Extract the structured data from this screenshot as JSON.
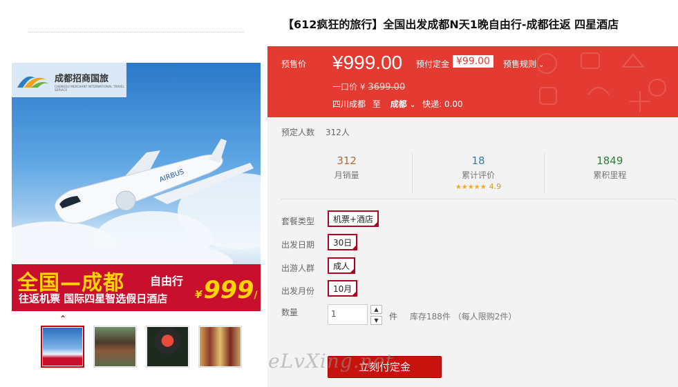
{
  "gallery": {
    "hero": {
      "logo_text": "成都招商国旅",
      "logo_sub": "CHENGDU MERCHANT INTERNATIONAL TRAVEL SERVICE",
      "banner_main": "全国—成都",
      "banner_free": "自由行",
      "banner_sub": "往返机票 国际四星智选假日酒店",
      "banner_price": "999",
      "banner_yen": "¥",
      "banner_per": "/人"
    },
    "thumbnails": [
      "thumb-plane",
      "thumb-temple",
      "thumb-opera",
      "thumb-puppets"
    ],
    "active_thumb": 0
  },
  "product": {
    "title": "【612疯狂的旅行】全国出发成都N天1晚自由行-成都往返 四星酒店",
    "presale_label": "预售价",
    "price": "¥999.00",
    "deposit_label": "预付定金",
    "deposit_value": "¥99.00",
    "rules_label": "预售规则",
    "one_price_label": "一口价 ¥",
    "one_price_value": "3699.00",
    "ship_from": "四川成都",
    "ship_to_label": "至",
    "ship_dest": "成都",
    "ship_fee": "快递: 0.00",
    "booked_label": "预定人数",
    "booked_value": "312人"
  },
  "stats": [
    {
      "num": "312",
      "cap": "月销量",
      "color": "#b36b3b"
    },
    {
      "num": "18",
      "cap": "累计评价",
      "color": "#3a7ba8",
      "stars": "★★★★★",
      "rating": "4.9"
    },
    {
      "num": "1849",
      "cap": "累积里程",
      "color": "#2f7d32"
    }
  ],
  "options": [
    {
      "label": "套餐类型",
      "value": "机票+酒店"
    },
    {
      "label": "出发日期",
      "value": "30日"
    },
    {
      "label": "出游人群",
      "value": "成人"
    },
    {
      "label": "出发月份",
      "value": "10月"
    }
  ],
  "quantity": {
    "label": "数量",
    "value": "1",
    "unit": "件",
    "stock": "库存188件 （每人限购2件）"
  },
  "buy_button": "立刻付定金",
  "watermark": "eLvXing.net",
  "colors": {
    "accent": "#e33a31",
    "option_border": "#b0001e",
    "buy": "#c8120d"
  }
}
